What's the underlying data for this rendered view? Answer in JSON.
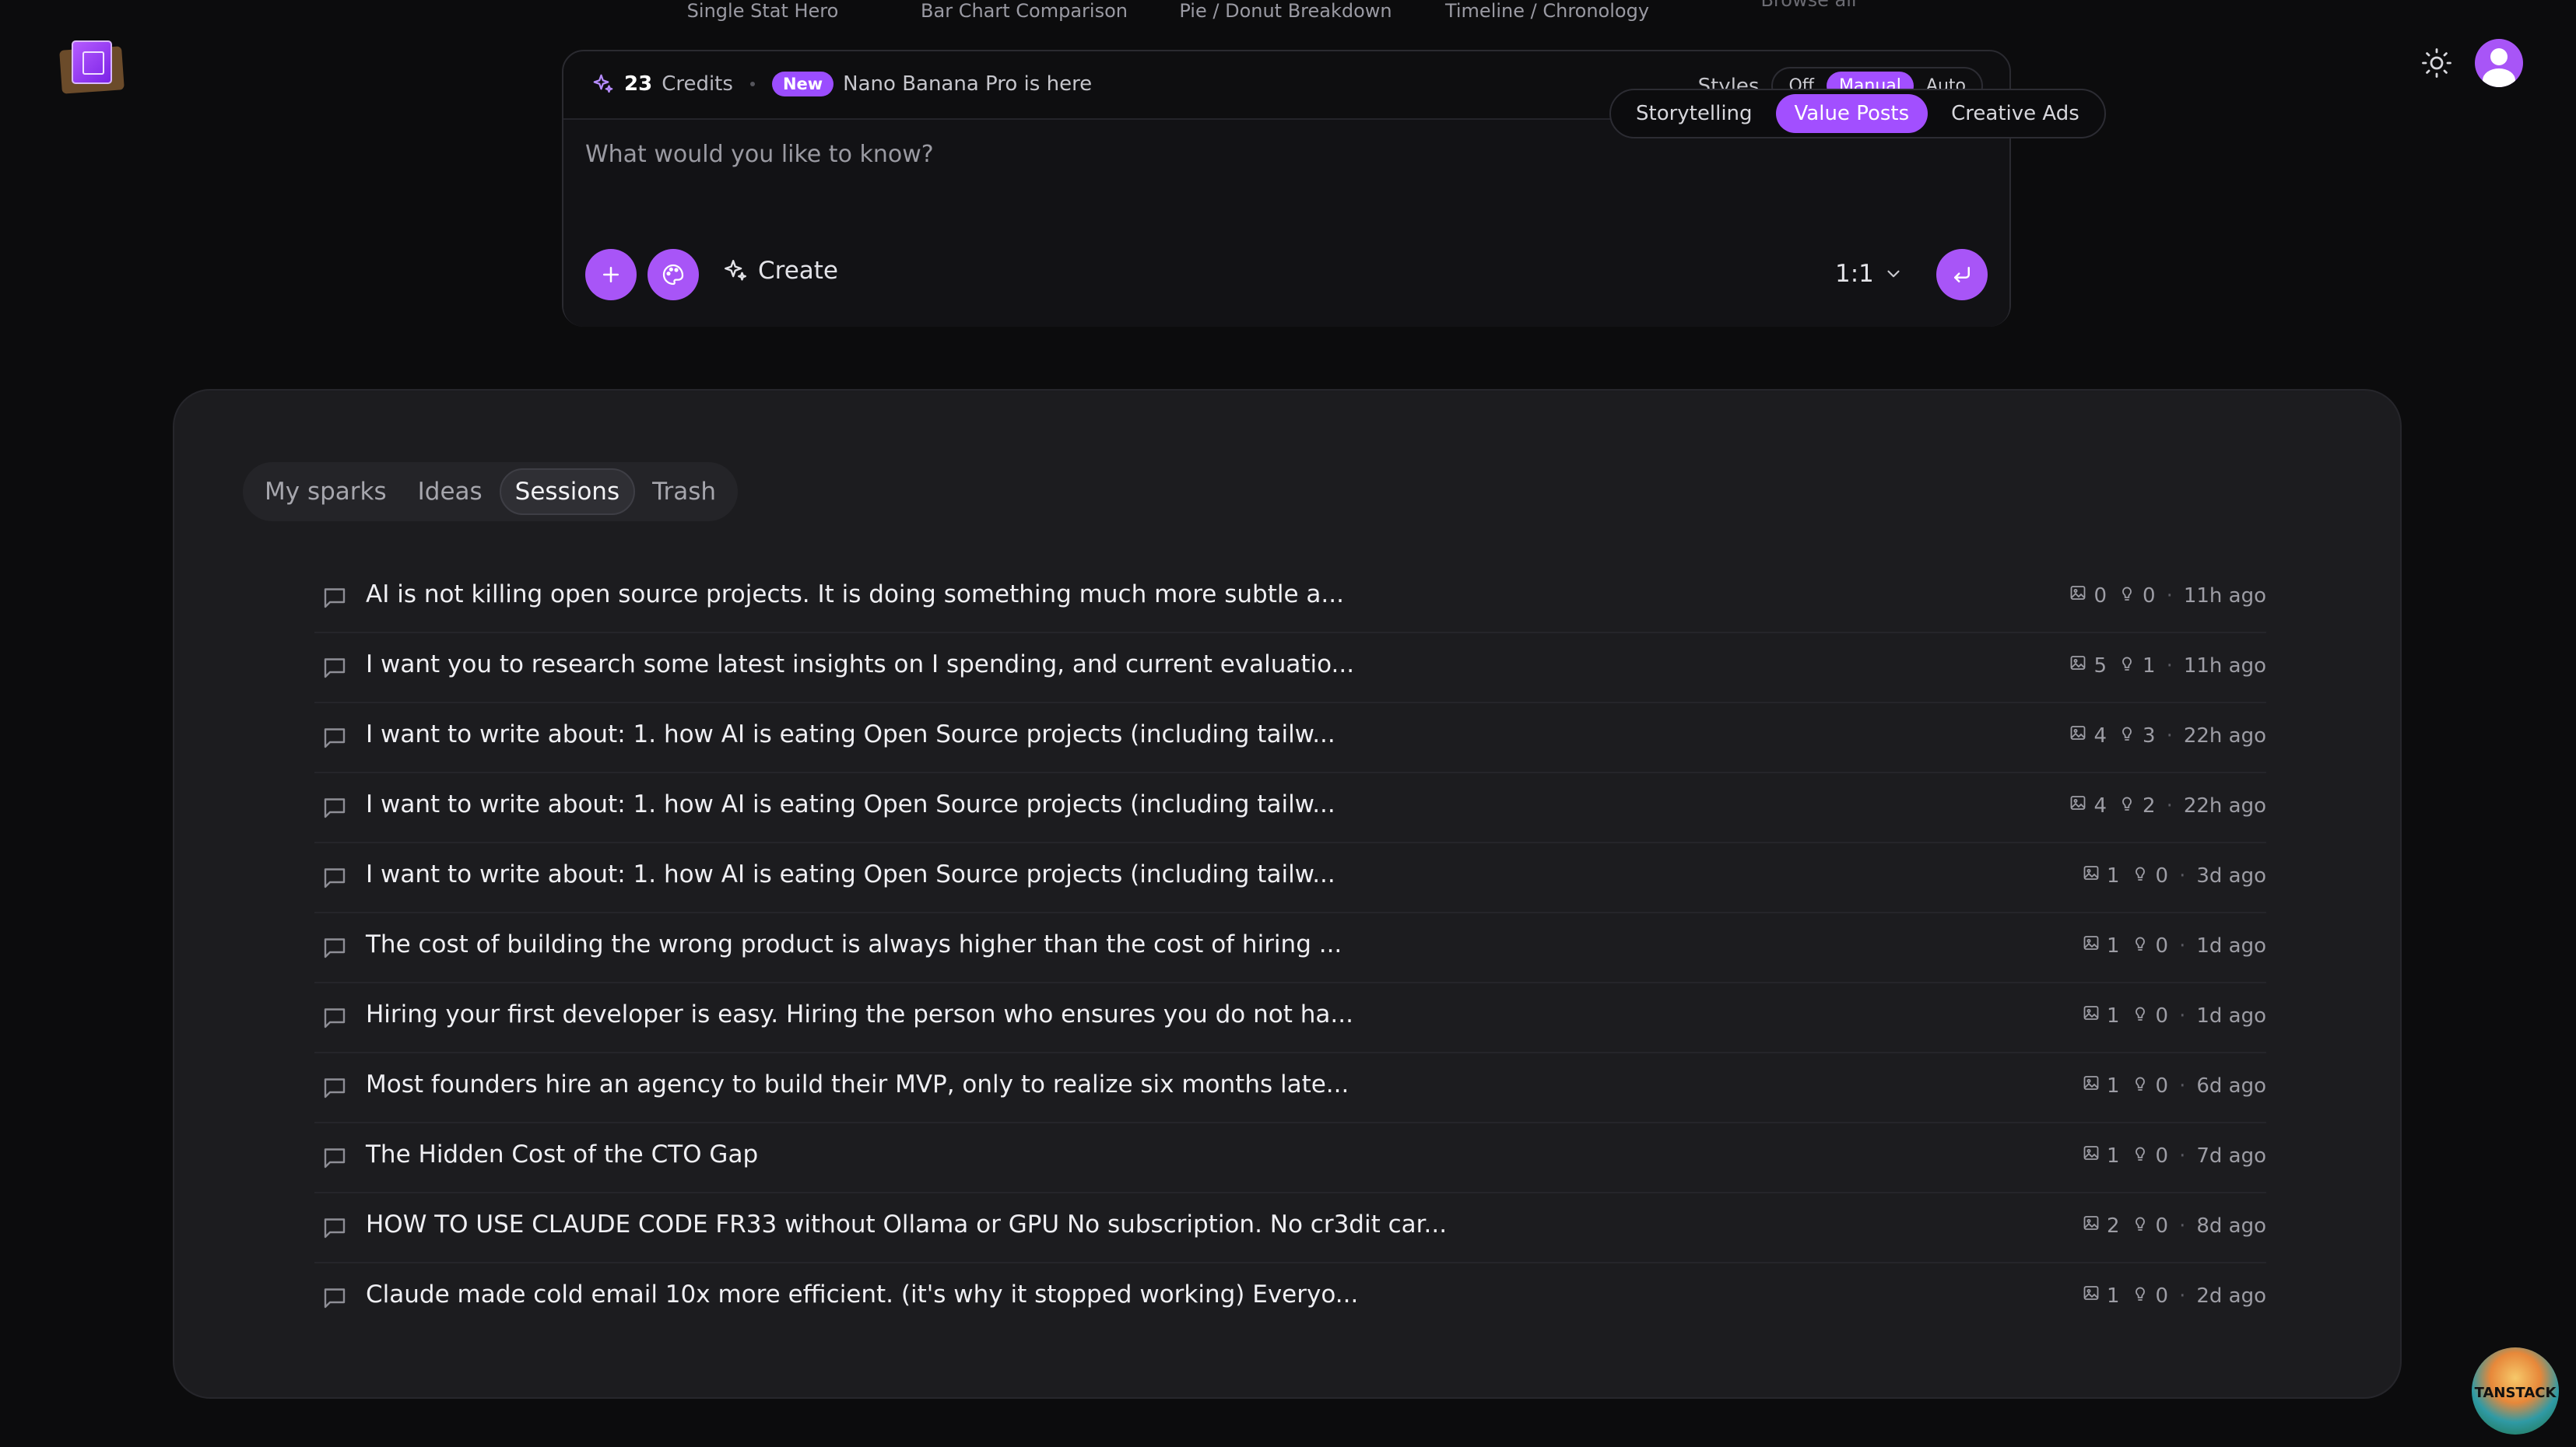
{
  "templates": [
    "Single Stat Hero",
    "Bar Chart Comparison",
    "Pie / Donut Breakdown",
    "Timeline / Chronology",
    "Browse all"
  ],
  "composer": {
    "credits_value": "23",
    "credits_label": "Credits",
    "new_badge": "New",
    "announcement": "Nano Banana Pro is here",
    "modes": [
      "Storytelling",
      "Value Posts",
      "Creative Ads"
    ],
    "styles_label": "Styles",
    "styles_options": [
      "Off",
      "Manual",
      "Auto"
    ],
    "prompt_placeholder": "What would you like to know?",
    "create_label": "Create",
    "aspect_ratio": "1:1"
  },
  "panel": {
    "tabs": [
      "My sparks",
      "Ideas",
      "Sessions",
      "Trash"
    ],
    "sessions": [
      {
        "title": "AI is not killing open source projects. It is doing something much more subtle a...",
        "images": "0",
        "ideas": "0",
        "time": "11h ago"
      },
      {
        "title": "I want you to research some latest insights on I spending, and current evaluatio...",
        "images": "5",
        "ideas": "1",
        "time": "11h ago"
      },
      {
        "title": "I want to write about: 1. how AI is eating Open Source projects (including tailw...",
        "images": "4",
        "ideas": "3",
        "time": "22h ago"
      },
      {
        "title": "I want to write about: 1. how AI is eating Open Source projects (including tailw...",
        "images": "4",
        "ideas": "2",
        "time": "22h ago"
      },
      {
        "title": "I want to write about: 1. how AI is eating Open Source projects (including tailw...",
        "images": "1",
        "ideas": "0",
        "time": "3d ago"
      },
      {
        "title": "The cost of building the wrong product is always higher than the cost of hiring ...",
        "images": "1",
        "ideas": "0",
        "time": "1d ago"
      },
      {
        "title": "Hiring your first developer is easy. Hiring the person who ensures you do not ha...",
        "images": "1",
        "ideas": "0",
        "time": "1d ago"
      },
      {
        "title": "Most founders hire an agency to build their MVP, only to realize six months late...",
        "images": "1",
        "ideas": "0",
        "time": "6d ago"
      },
      {
        "title": "The Hidden Cost of the CTO Gap",
        "images": "1",
        "ideas": "0",
        "time": "7d ago"
      },
      {
        "title": "HOW TO USE CLAUDE CODE FR33 without Ollama or GPU No subscription. No cr3dit car...",
        "images": "2",
        "ideas": "0",
        "time": "8d ago"
      },
      {
        "title": "Claude made cold email 10x more efficient. (it's why it stopped working) Everyo...",
        "images": "1",
        "ideas": "0",
        "time": "2d ago"
      }
    ]
  },
  "badge": {
    "tanstack_label": "TANSTACK"
  },
  "colors": {
    "accent": "#a855f7",
    "background": "#0c0c0d",
    "panel": "#1c1c1f"
  }
}
